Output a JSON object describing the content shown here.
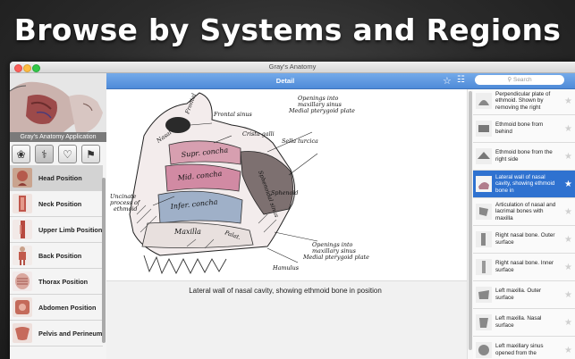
{
  "headline": "Browse by Systems and Regions",
  "window": {
    "title": "Gray's Anatomy"
  },
  "sidebar": {
    "app_label": "Gray's Anatomy Application",
    "tabs": [
      {
        "icon": "brain-icon"
      },
      {
        "icon": "body-systems-icon"
      },
      {
        "icon": "heart-icon"
      },
      {
        "icon": "bookmark-icon"
      }
    ],
    "items": [
      {
        "label": "Head Position",
        "selected": true
      },
      {
        "label": "Neck Position"
      },
      {
        "label": "Upper Limb Position"
      },
      {
        "label": "Back Position"
      },
      {
        "label": "Thorax Position"
      },
      {
        "label": "Abdomen Position"
      },
      {
        "label": "Pelvis and Perineum"
      }
    ]
  },
  "toolbar": {
    "title": "Detail",
    "favorite_icon": "star-icon",
    "bookmark_icon": "bookmarks-icon"
  },
  "search": {
    "placeholder": "Search"
  },
  "figure": {
    "caption": "Lateral wall of nasal cavity, showing ethmoid bone in position",
    "labels": {
      "frontal_sinus": "Frontal sinus",
      "crista_galli": "Crista galli",
      "openings_top_1": "Openings into",
      "openings_top_2": "maxillary sinus",
      "openings_top_3": "Medial pterygoid plate",
      "sella": "Sella turcica",
      "nasal": "Nasal",
      "frontal": "Frontal",
      "supr_concha": "Supr. concha",
      "mid_concha": "Mid. concha",
      "sphenoidal": "Sphenoidal sinus",
      "sphenoid": "Sphenoid",
      "infer_concha": "Infer. concha",
      "maxilla": "Maxilla",
      "palat": "Palat.",
      "uncinate_1": "Uncinate",
      "uncinate_2": "process of",
      "uncinate_3": "ethmoid",
      "openings_bot_1": "Openings into",
      "openings_bot_2": "maxillary sinus",
      "openings_bot_3": "Medial pterygoid plate",
      "hamulus": "Hamulus"
    }
  },
  "right_list": [
    {
      "text": "Perpendicular plate of ethmoid. Shown by removing the right"
    },
    {
      "text": "Ethmoid bone from behind"
    },
    {
      "text": "Ethmoid bone from the right side"
    },
    {
      "text": "Lateral wall of nasal cavity, showing ethmoid bone in",
      "selected": true
    },
    {
      "text": "Articulation of nasal and lacrimal bones with maxilla"
    },
    {
      "text": "Right nasal bone. Outer surface"
    },
    {
      "text": "Right nasal bone. Inner surface"
    },
    {
      "text": "Left maxilla. Outer surface"
    },
    {
      "text": "Left maxilla. Nasal surface"
    },
    {
      "text": "Left maxillary sinus opened from the"
    }
  ]
}
